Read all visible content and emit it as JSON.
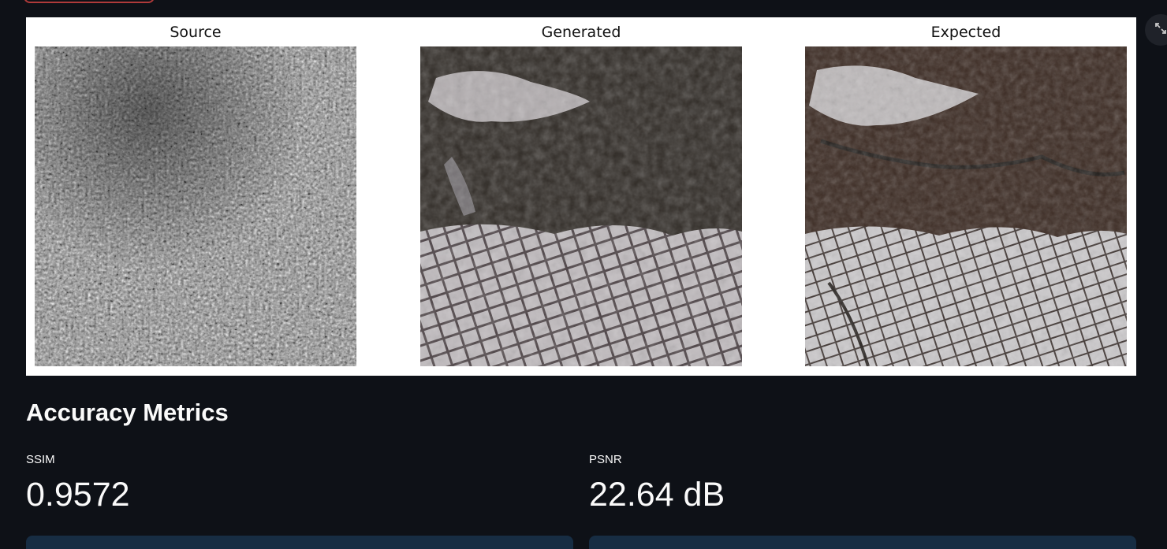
{
  "figure": {
    "panels": [
      {
        "title": "Source"
      },
      {
        "title": "Generated"
      },
      {
        "title": "Expected"
      }
    ]
  },
  "metrics": {
    "section_title": "Accuracy Metrics",
    "ssim": {
      "label": "SSIM",
      "value": "0.9572"
    },
    "psnr": {
      "label": "PSNR",
      "value": "22.64 dB"
    }
  },
  "icons": {
    "fullscreen": "expand-icon"
  },
  "colors": {
    "background": "#0e1117",
    "card": "#172d43",
    "figure_bg": "#ffffff"
  }
}
